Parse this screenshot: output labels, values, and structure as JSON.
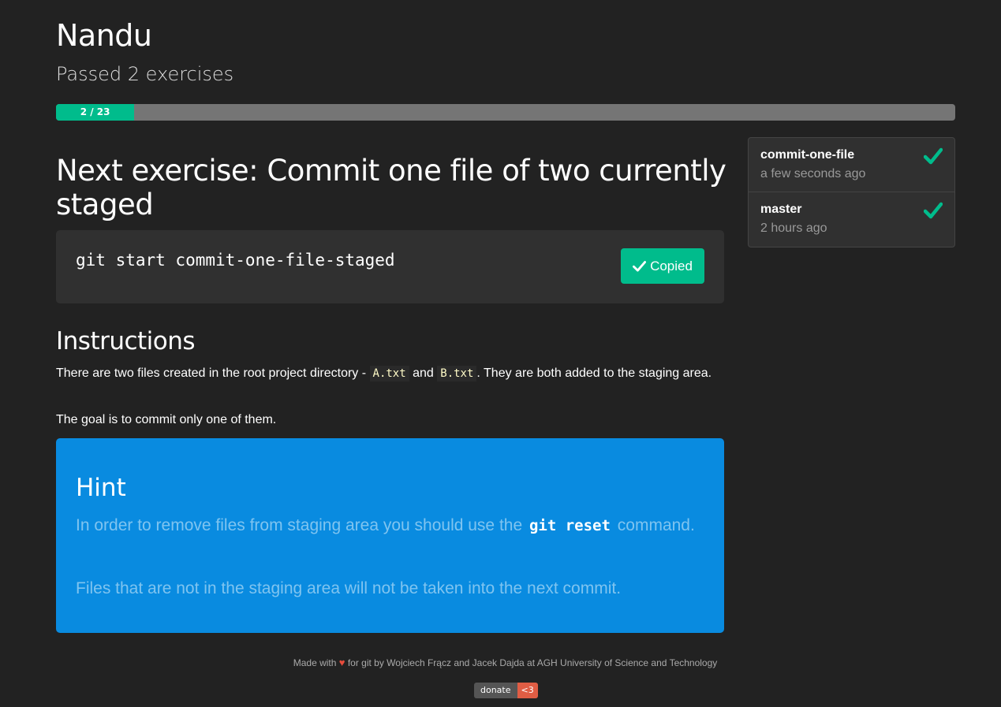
{
  "user": {
    "name": "Nandu",
    "passed_text": "Passed 2 exercises"
  },
  "progress": {
    "label": "2 / 23",
    "completed": 2,
    "total": 23
  },
  "next_exercise": {
    "title": "Next exercise: Commit one file of two currently staged",
    "command": "git start commit-one-file-staged",
    "copy_button_label": "Copied"
  },
  "instructions": {
    "heading": "Instructions",
    "p1_before": "There are two files created in the root project directory - ",
    "file_a": "A.txt",
    "p1_and": " and ",
    "file_b": "B.txt",
    "p1_after": ". They are both added to the staging area.",
    "p2": "The goal is to commit only one of them."
  },
  "hint": {
    "title": "Hint",
    "p1_before": "In order to remove files from staging area you should use the ",
    "p1_code": "git reset",
    "p1_after": " command.",
    "p2": "Files that are not in the staging area will not be taken into the next commit."
  },
  "branches": [
    {
      "name": "commit-one-file",
      "time": "a few seconds ago",
      "icon": "check-icon"
    },
    {
      "name": "master",
      "time": "2 hours ago",
      "icon": "check-icon"
    }
  ],
  "footer": {
    "made_with": "Made with",
    "credits": "for git by Wojciech Frącz and Jacek Dajda at AGH University of Science and Technology",
    "donate_label": "donate",
    "donate_badge": "<3"
  },
  "colors": {
    "background": "#222222",
    "accent": "#00bc8c",
    "hint_bg": "#098be0",
    "heart": "#e74c3c"
  }
}
